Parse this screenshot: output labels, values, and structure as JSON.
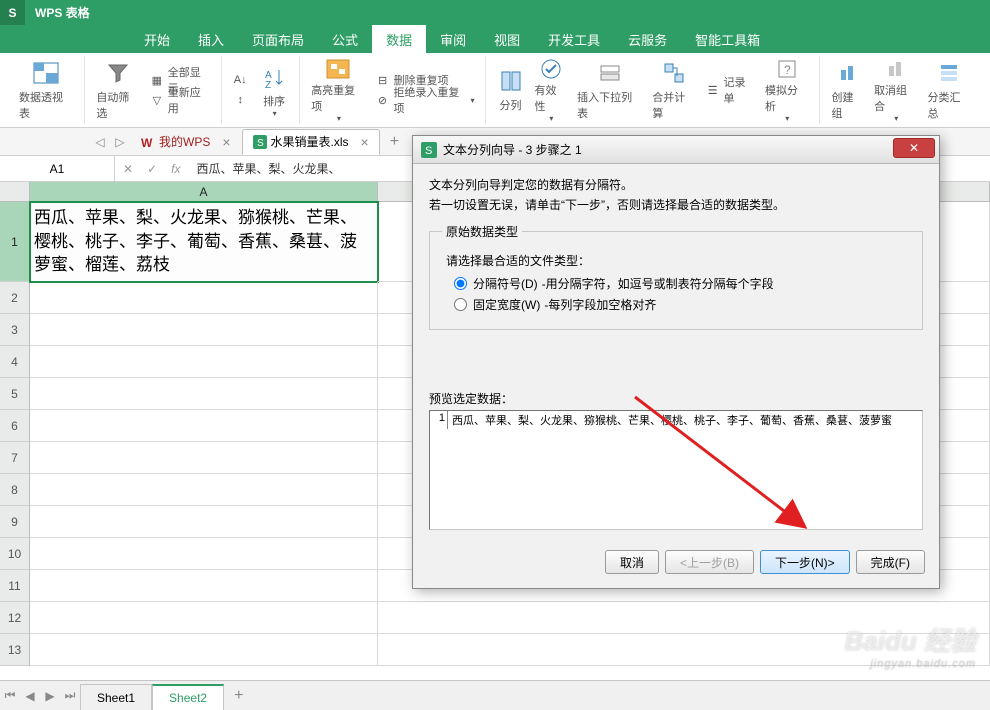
{
  "app": {
    "name": "WPS 表格"
  },
  "menu": {
    "items": [
      "开始",
      "插入",
      "页面布局",
      "公式",
      "数据",
      "审阅",
      "视图",
      "开发工具",
      "云服务",
      "智能工具箱"
    ],
    "activeIndex": 4
  },
  "ribbon": {
    "pivotTable": "数据透视表",
    "autoFilter": "自动筛选",
    "showAll": "全部显示",
    "reapply": "重新应用",
    "sort": "排序",
    "highlightDup": "高亮重复项",
    "removeDup": "删除重复项",
    "rejectDup": "拒绝录入重复项",
    "textToColumns": "分列",
    "validation": "有效性",
    "insertDropdown": "插入下拉列表",
    "consolidate": "合并计算",
    "recordForm": "记录单",
    "whatIf": "模拟分析",
    "group": "创建组",
    "ungroup": "取消组合",
    "subtotal": "分类汇总"
  },
  "docTabs": {
    "myWps": "我的WPS",
    "active": {
      "name": "水果销量表.xls"
    }
  },
  "formulaBar": {
    "cellRef": "A1",
    "content": "西瓜、苹果、梨、火龙果、"
  },
  "columns": {
    "A": "A"
  },
  "rows": [
    "1",
    "2",
    "3",
    "4",
    "5",
    "6",
    "7",
    "8",
    "9",
    "10",
    "11",
    "12",
    "13"
  ],
  "cellA1": "西瓜、苹果、梨、火龙果、猕猴桃、芒果、樱桃、桃子、李子、葡萄、香蕉、桑葚、菠萝蜜、榴莲、荔枝",
  "dialog": {
    "title": "文本分列向导 - 3 步骤之 1",
    "intro1": "文本分列向导判定您的数据有分隔符。",
    "intro2": "若一切设置无误，请单击“下一步”，否则请选择最合适的数据类型。",
    "legend": "原始数据类型",
    "chooseLabel": "请选择最合适的文件类型：",
    "radio1": "分隔符号(D)",
    "radio1desc": "-用分隔字符，如逗号或制表符分隔每个字段",
    "radio2": "固定宽度(W)",
    "radio2desc": "-每列字段加空格对齐",
    "previewLabel": "预览选定数据：",
    "previewRowNum": "1",
    "previewRow": "西瓜、苹果、梨、火龙果、猕猴桃、芒果、樱桃、桃子、李子、葡萄、香蕉、桑葚、菠萝蜜",
    "btnCancel": "取消",
    "btnPrev": "<上一步(B)",
    "btnNext": "下一步(N)>",
    "btnFinish": "完成(F)"
  },
  "sheets": {
    "tabs": [
      "Sheet1",
      "Sheet2"
    ],
    "activeIndex": 1
  },
  "watermark": {
    "main": "Baidu 经验",
    "sub": "jingyan.baidu.com"
  }
}
